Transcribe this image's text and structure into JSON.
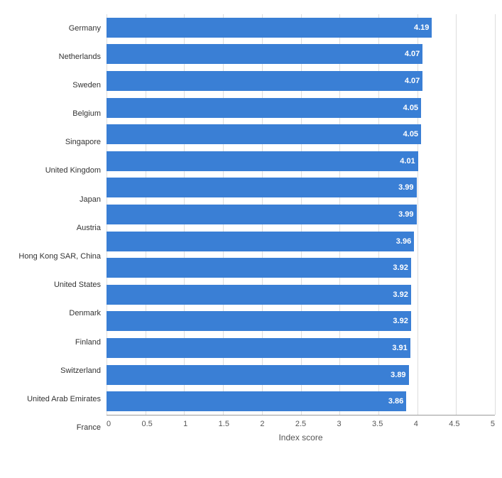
{
  "chart": {
    "title": "Index score",
    "bars": [
      {
        "country": "Germany",
        "value": 4.19,
        "pct": 83.8
      },
      {
        "country": "Netherlands",
        "value": 4.07,
        "pct": 81.4
      },
      {
        "country": "Sweden",
        "value": 4.07,
        "pct": 81.4
      },
      {
        "country": "Belgium",
        "value": 4.05,
        "pct": 81.0
      },
      {
        "country": "Singapore",
        "value": 4.05,
        "pct": 81.0
      },
      {
        "country": "United Kingdom",
        "value": 4.01,
        "pct": 80.2
      },
      {
        "country": "Japan",
        "value": 3.99,
        "pct": 79.8
      },
      {
        "country": "Austria",
        "value": 3.99,
        "pct": 79.8
      },
      {
        "country": "Hong Kong SAR, China",
        "value": 3.96,
        "pct": 79.2
      },
      {
        "country": "United States",
        "value": 3.92,
        "pct": 78.4
      },
      {
        "country": "Denmark",
        "value": 3.92,
        "pct": 78.4
      },
      {
        "country": "Finland",
        "value": 3.92,
        "pct": 78.4
      },
      {
        "country": "Switzerland",
        "value": 3.91,
        "pct": 78.2
      },
      {
        "country": "United Arab Emirates",
        "value": 3.89,
        "pct": 77.8
      },
      {
        "country": "France",
        "value": 3.86,
        "pct": 77.2
      }
    ],
    "x_ticks": [
      "0",
      "0.5",
      "1",
      "1.5",
      "2",
      "2.5",
      "3",
      "3.5",
      "4",
      "4.5",
      "5"
    ],
    "x_label": "Index score",
    "bar_color": "#3a7fd5",
    "max_value": 5
  }
}
